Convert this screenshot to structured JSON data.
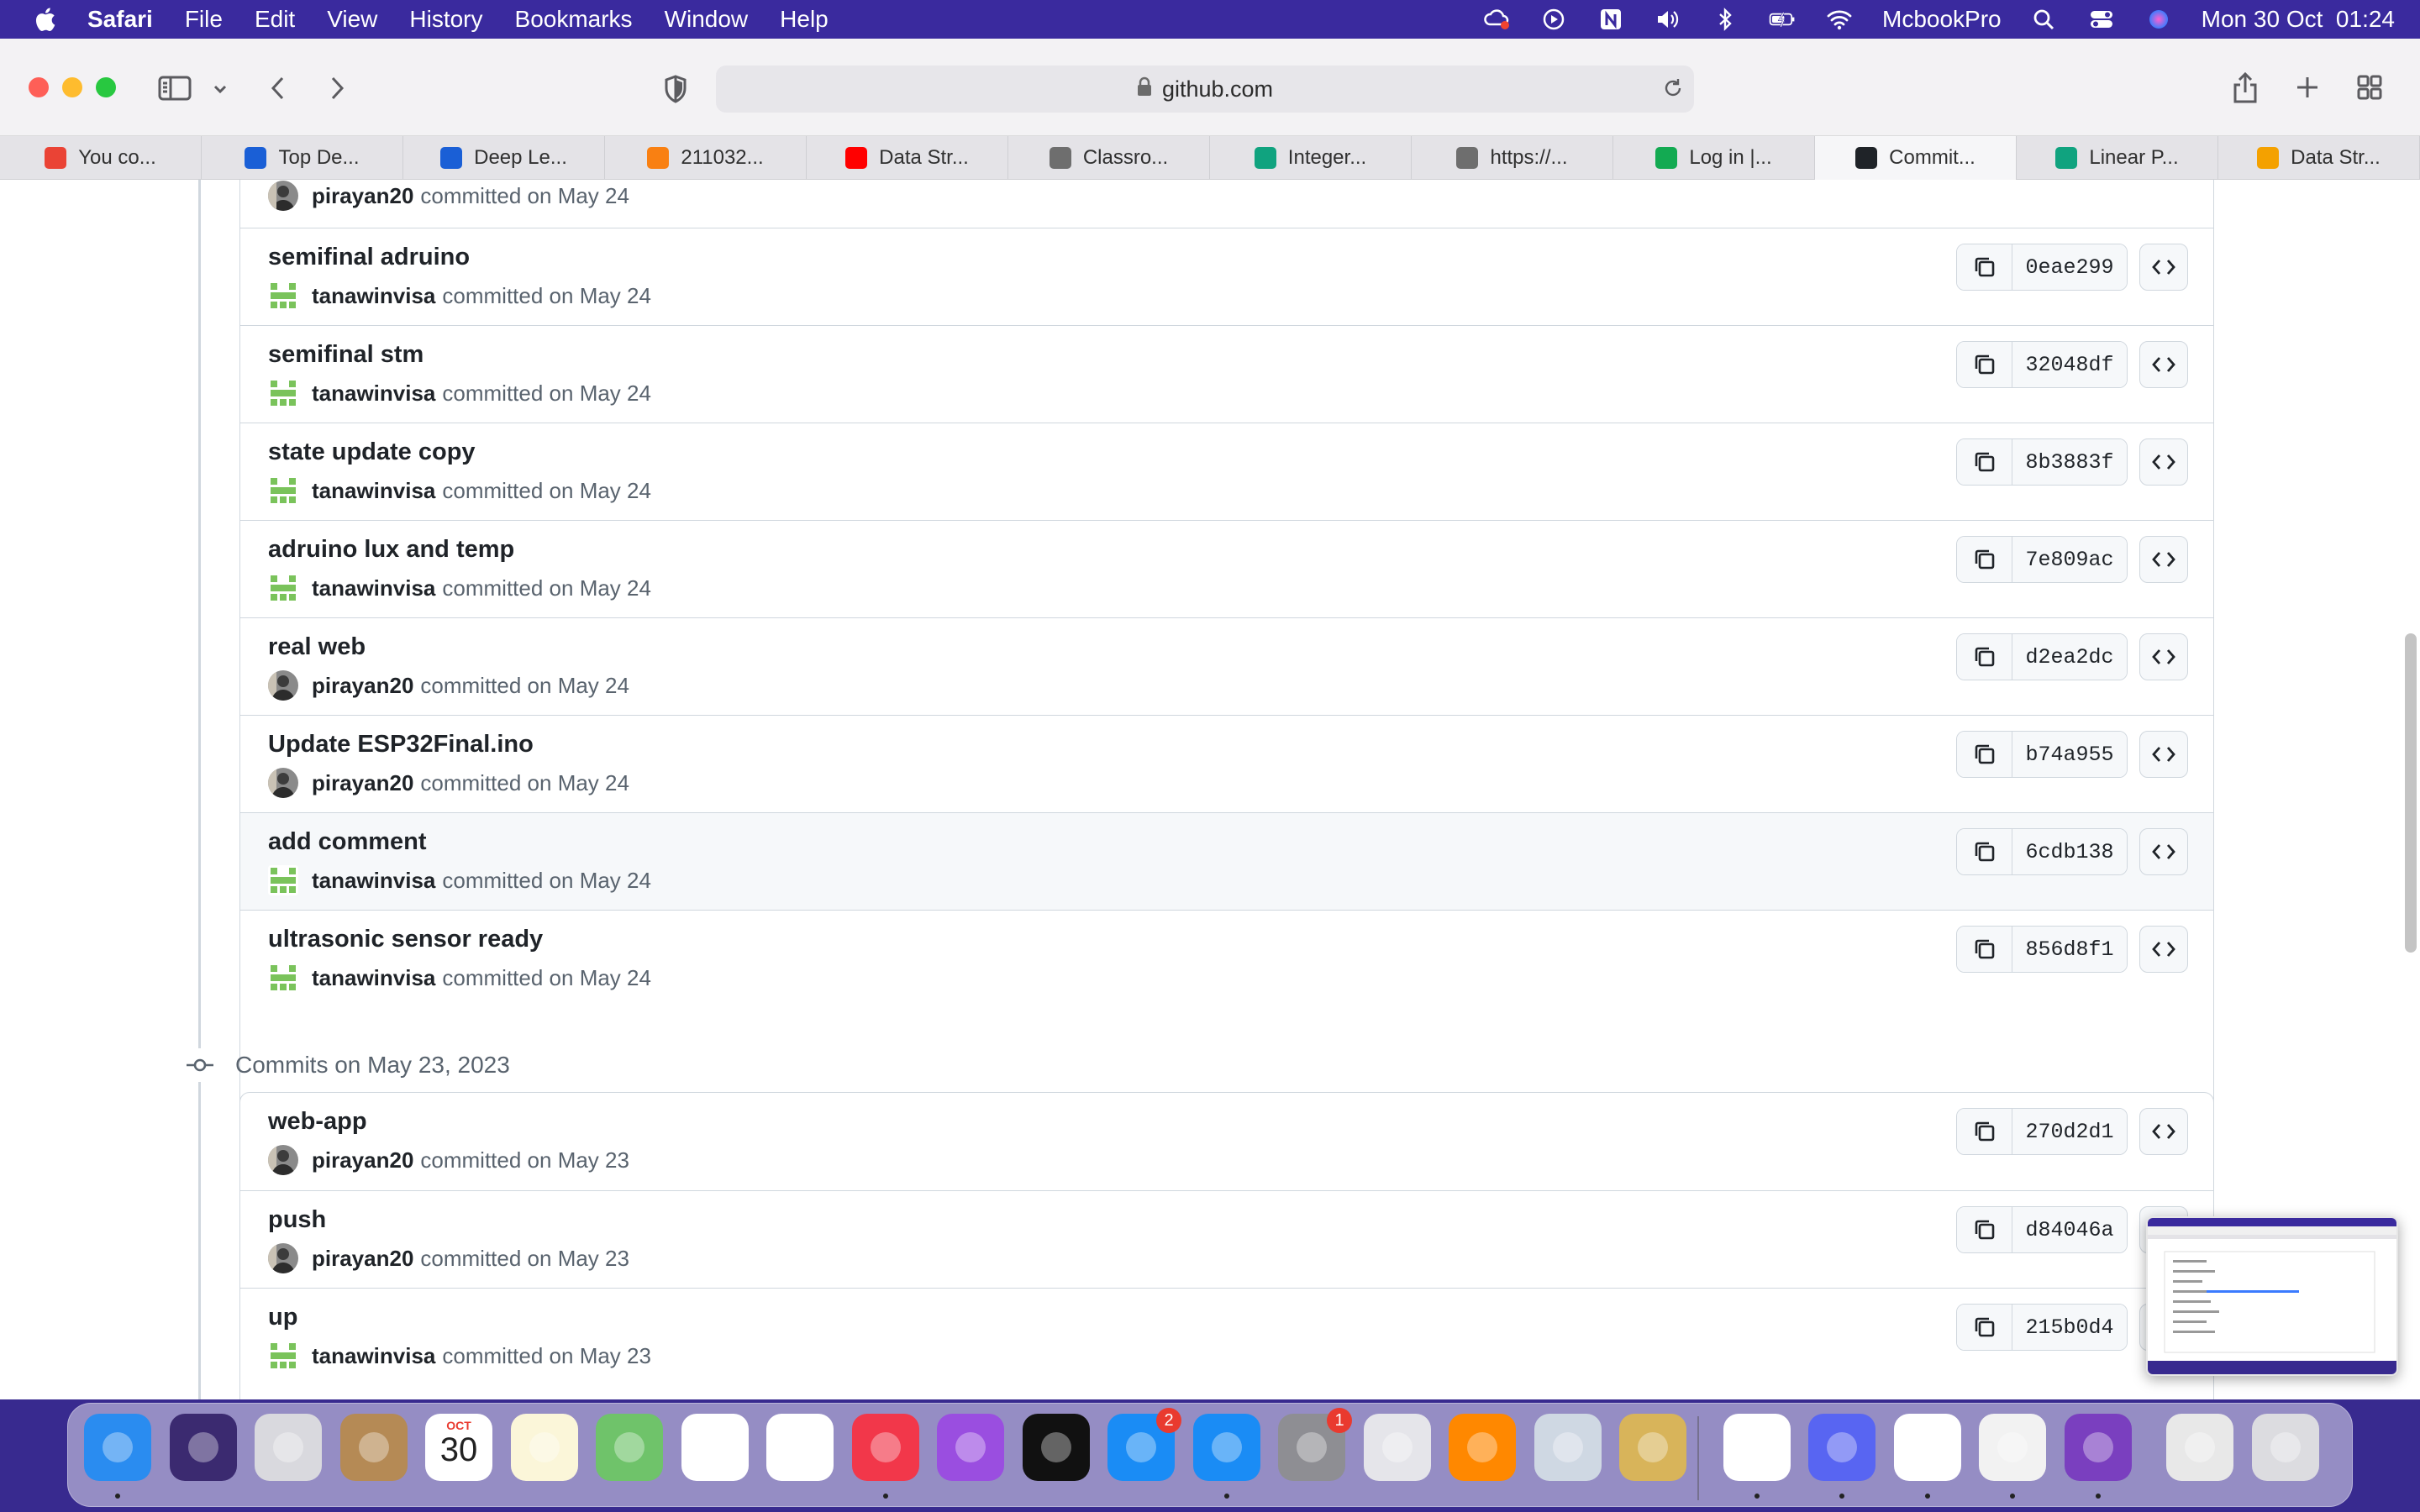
{
  "menubar": {
    "app": "Safari",
    "items": [
      "File",
      "Edit",
      "View",
      "History",
      "Bookmarks",
      "Window",
      "Help"
    ],
    "username": "McbookPro",
    "datetime": "Mon 30 Oct  01:24"
  },
  "toolbar": {
    "url": "github.com"
  },
  "tabs": [
    {
      "label": "You co...",
      "icon": "gmail-icon",
      "color": "#ea4335"
    },
    {
      "label": "Top De...",
      "icon": "chrome-c-icon",
      "color": "#1a5fd6"
    },
    {
      "label": "Deep Le...",
      "icon": "chrome-c-icon",
      "color": "#1a5fd6"
    },
    {
      "label": "211032...",
      "icon": "moodle-icon",
      "color": "#f98012"
    },
    {
      "label": "Data Str...",
      "icon": "youtube-icon",
      "color": "#ff0000"
    },
    {
      "label": "Classro...",
      "icon": "letter-e-icon",
      "color": "#6e6e6e"
    },
    {
      "label": "Integer...",
      "icon": "openai-icon",
      "color": "#10a37f"
    },
    {
      "label": "https://...",
      "icon": "letter-a-icon",
      "color": "#6e6e6e"
    },
    {
      "label": "Log in |...",
      "icon": "mongodb-leaf-icon",
      "color": "#13aa52"
    },
    {
      "label": "Commit...",
      "icon": "github-icon",
      "color": "#1f2328",
      "active": true
    },
    {
      "label": "Linear P...",
      "icon": "openai-icon",
      "color": "#10a37f"
    },
    {
      "label": "Data Str...",
      "icon": "geeks-icon",
      "color": "#f4a100"
    }
  ],
  "top_partial": {
    "author": "pirayan20",
    "text": "committed on May 24"
  },
  "groups": [
    {
      "header": "",
      "commits": [
        {
          "message": "semifinal adruino",
          "author": "tanawinvisa",
          "text": "committed on May 24",
          "sha": "0eae299",
          "avatar": "green"
        },
        {
          "message": "semifinal stm",
          "author": "tanawinvisa",
          "text": "committed on May 24",
          "sha": "32048df",
          "avatar": "green"
        },
        {
          "message": "state update copy",
          "author": "tanawinvisa",
          "text": "committed on May 24",
          "sha": "8b3883f",
          "avatar": "green"
        },
        {
          "message": "adruino lux and temp",
          "author": "tanawinvisa",
          "text": "committed on May 24",
          "sha": "7e809ac",
          "avatar": "green"
        },
        {
          "message": "real web",
          "author": "pirayan20",
          "text": "committed on May 24",
          "sha": "d2ea2dc",
          "avatar": "photo"
        },
        {
          "message": "Update ESP32Final.ino",
          "author": "pirayan20",
          "text": "committed on May 24",
          "sha": "b74a955",
          "avatar": "photo"
        },
        {
          "message": "add comment",
          "author": "tanawinvisa",
          "text": "committed on May 24",
          "sha": "6cdb138",
          "avatar": "green",
          "hover": true
        },
        {
          "message": "ultrasonic sensor ready",
          "author": "tanawinvisa",
          "text": "committed on May 24",
          "sha": "856d8f1",
          "avatar": "green"
        }
      ]
    },
    {
      "header": "Commits on May 23, 2023",
      "commits": [
        {
          "message": "web-app",
          "author": "pirayan20",
          "text": "committed on May 23",
          "sha": "270d2d1",
          "avatar": "photo"
        },
        {
          "message": "push",
          "author": "pirayan20",
          "text": "committed on May 23",
          "sha": "d84046a",
          "avatar": "photo"
        },
        {
          "message": "up",
          "author": "tanawinvisa",
          "text": "committed on May 23",
          "sha": "215b0d4",
          "avatar": "green"
        }
      ]
    }
  ],
  "dock": {
    "apps": [
      {
        "name": "finder-icon",
        "color": "#2a8cf0",
        "running": true
      },
      {
        "name": "siri-icon",
        "color": "#3b2a70"
      },
      {
        "name": "launchpad-icon",
        "color": "#d9d9de"
      },
      {
        "name": "contacts-icon",
        "color": "#b58a55"
      },
      {
        "name": "calendar-icon",
        "color": "#ffffff",
        "text_month": "OCT",
        "text_day": "30"
      },
      {
        "name": "notes-icon",
        "color": "#fbf6d9"
      },
      {
        "name": "maps-icon",
        "color": "#6fc36a"
      },
      {
        "name": "photos-icon",
        "color": "#ffffff"
      },
      {
        "name": "keynote-icon",
        "color": "#ffffff"
      },
      {
        "name": "music-icon",
        "color": "#f2374a",
        "running": true
      },
      {
        "name": "podcasts-icon",
        "color": "#9a4ee0"
      },
      {
        "name": "apple-tv-icon",
        "color": "#111111"
      },
      {
        "name": "app-store-icon",
        "color": "#1a8cf5",
        "badge": "2"
      },
      {
        "name": "safari-icon",
        "color": "#1a8cf5",
        "running": true
      },
      {
        "name": "system-settings-icon",
        "color": "#8e8e93",
        "badge": "1"
      },
      {
        "name": "disk-utility-icon",
        "color": "#e5e5ea"
      },
      {
        "name": "vlc-icon",
        "color": "#ff8800"
      },
      {
        "name": "preview-icon",
        "color": "#cfd8e3"
      },
      {
        "name": "cocktail-icon",
        "color": "#d8b45a"
      },
      {
        "name": "chrome-icon",
        "color": "#ffffff",
        "running": true
      },
      {
        "name": "discord-icon",
        "color": "#5865f2",
        "running": true
      },
      {
        "name": "vscode-icon",
        "color": "#ffffff",
        "running": true
      },
      {
        "name": "textedit-icon",
        "color": "#f2f2f2",
        "running": true
      },
      {
        "name": "github-desktop-icon",
        "color": "#7a3fbf",
        "running": true
      },
      {
        "name": "documents-stack-icon",
        "color": "#e8e8e8"
      },
      {
        "name": "trash-icon",
        "color": "#dcdce0"
      }
    ]
  },
  "colors": {
    "menubar": "#3a2a9e",
    "accent_green_avatar": "#7ac35b",
    "border": "#d0d7de"
  }
}
